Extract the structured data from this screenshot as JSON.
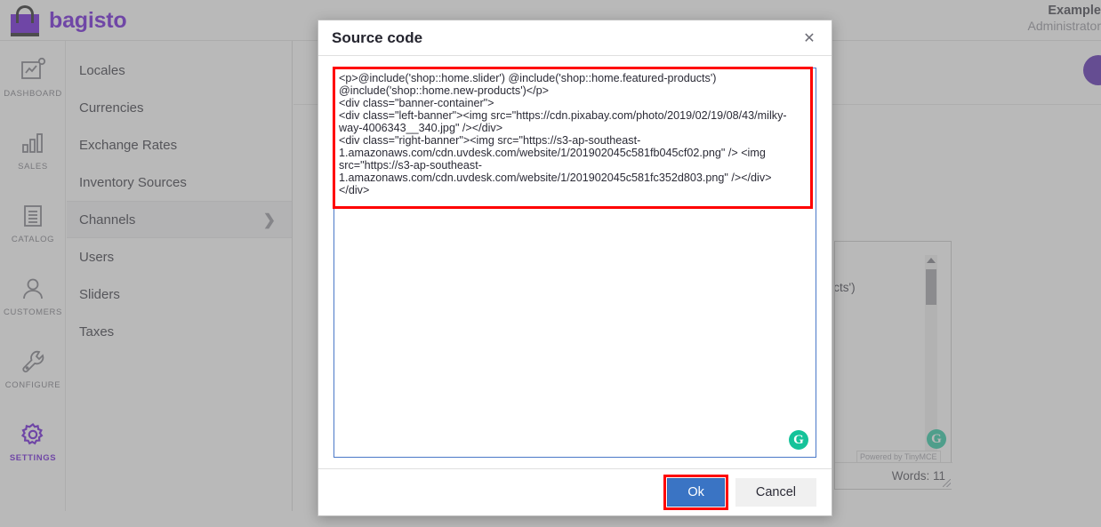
{
  "header": {
    "brand": "bagisto",
    "brand_color": "#5c00d4",
    "account_name": "Example",
    "account_role": "Administrator"
  },
  "rail": {
    "items": [
      {
        "label": "DASHBOARD",
        "icon": "dashboard-chart-icon",
        "active": false
      },
      {
        "label": "SALES",
        "icon": "bar-chart-icon",
        "active": false
      },
      {
        "label": "CATALOG",
        "icon": "document-lines-icon",
        "active": false
      },
      {
        "label": "CUSTOMERS",
        "icon": "person-icon",
        "active": false
      },
      {
        "label": "CONFIGURE",
        "icon": "wrench-icon",
        "active": false
      },
      {
        "label": "SETTINGS",
        "icon": "gear-icon",
        "active": true
      }
    ]
  },
  "subnav": {
    "items": [
      {
        "label": "Locales",
        "selected": false,
        "has_chevron": false
      },
      {
        "label": "Currencies",
        "selected": false,
        "has_chevron": false
      },
      {
        "label": "Exchange Rates",
        "selected": false,
        "has_chevron": false
      },
      {
        "label": "Inventory Sources",
        "selected": false,
        "has_chevron": false
      },
      {
        "label": "Channels",
        "selected": true,
        "has_chevron": true
      },
      {
        "label": "Users",
        "selected": false,
        "has_chevron": false
      },
      {
        "label": "Sliders",
        "selected": false,
        "has_chevron": false
      },
      {
        "label": "Taxes",
        "selected": false,
        "has_chevron": false
      }
    ],
    "chevron_glyph": "❯"
  },
  "background_editor": {
    "visible_text": "ew-products')",
    "credit": "Powered by TinyMCE",
    "word_count": "Words: 11",
    "grammarly_glyph": "G",
    "grammarly_color": "#15c39a"
  },
  "modal": {
    "title": "Source code",
    "close_glyph": "✕",
    "code": "<p>@include('shop::home.slider') @include('shop::home.featured-products') @include('shop::home.new-products')</p>\n<div class=\"banner-container\">\n<div class=\"left-banner\"><img src=\"https://cdn.pixabay.com/photo/2019/02/19/08/43/milky-way-4006343__340.jpg\" /></div>\n<div class=\"right-banner\"><img src=\"https://s3-ap-southeast-1.amazonaws.com/cdn.uvdesk.com/website/1/201902045c581fb045cf02.png\" /> <img src=\"https://s3-ap-southeast-1.amazonaws.com/cdn.uvdesk.com/website/1/201902045c581fc352d803.png\" /></div>\n</div>",
    "grammarly_glyph": "G",
    "ok_label": "Ok",
    "cancel_label": "Cancel",
    "ok_color": "#3a74c4",
    "highlight_color": "#ff0000"
  }
}
